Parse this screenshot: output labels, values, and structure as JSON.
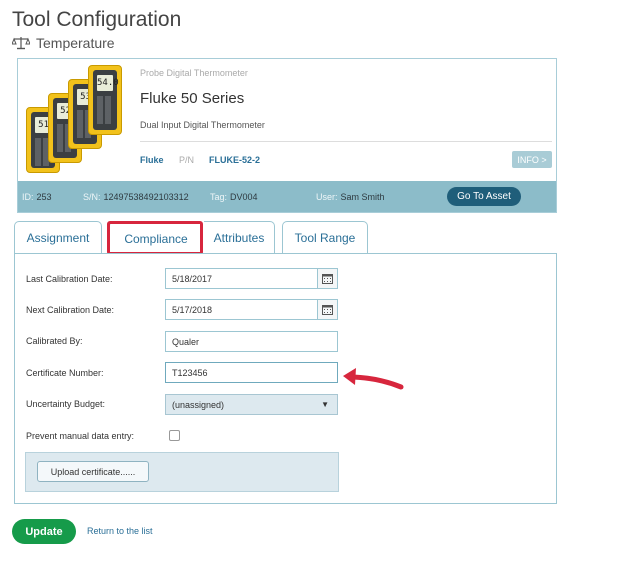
{
  "page": {
    "title": "Tool Configuration",
    "subtitle": "Temperature",
    "subtitle_icon": "balance-scale-icon"
  },
  "asset": {
    "category": "Probe Digital Thermometer",
    "name": "Fluke 50 Series",
    "description": "Dual Input Digital Thermometer",
    "brand": "Fluke",
    "pn_label": "P/N",
    "pn": "FLUKE-52-2",
    "info_button": "INFO >",
    "id_label": "ID:",
    "id": "253",
    "sn_label": "S/N:",
    "sn": "12497538492103312",
    "tag_label": "Tag:",
    "tag": "DV004",
    "user_label": "User:",
    "user": "Sam Smith",
    "go_button": "Go To Asset",
    "image_screens": [
      "51",
      "52",
      "53",
      "54.0"
    ]
  },
  "tabs": [
    {
      "label": "Assignment"
    },
    {
      "label": "Compliance",
      "active": true
    },
    {
      "label": "Attributes"
    },
    {
      "label": "Tool Range"
    }
  ],
  "form": {
    "last_cal_label": "Last Calibration Date:",
    "last_cal_value": "5/18/2017",
    "next_cal_label": "Next Calibration Date:",
    "next_cal_value": "5/17/2018",
    "calibrated_by_label": "Calibrated By:",
    "calibrated_by_value": "Qualer",
    "certificate_label": "Certificate Number:",
    "certificate_value": "T123456",
    "uncertainty_label": "Uncertainty Budget:",
    "uncertainty_value": "(unassigned)",
    "prevent_label": "Prevent manual data entry:",
    "prevent_checked": false,
    "upload_button": "Upload certificate......"
  },
  "footer": {
    "update_button": "Update",
    "return_link": "Return to the list"
  },
  "colors": {
    "accent": "#2a6f97",
    "bar": "#8cbcc9",
    "update_green": "#169b4a",
    "highlight_red": "#d7263d"
  }
}
